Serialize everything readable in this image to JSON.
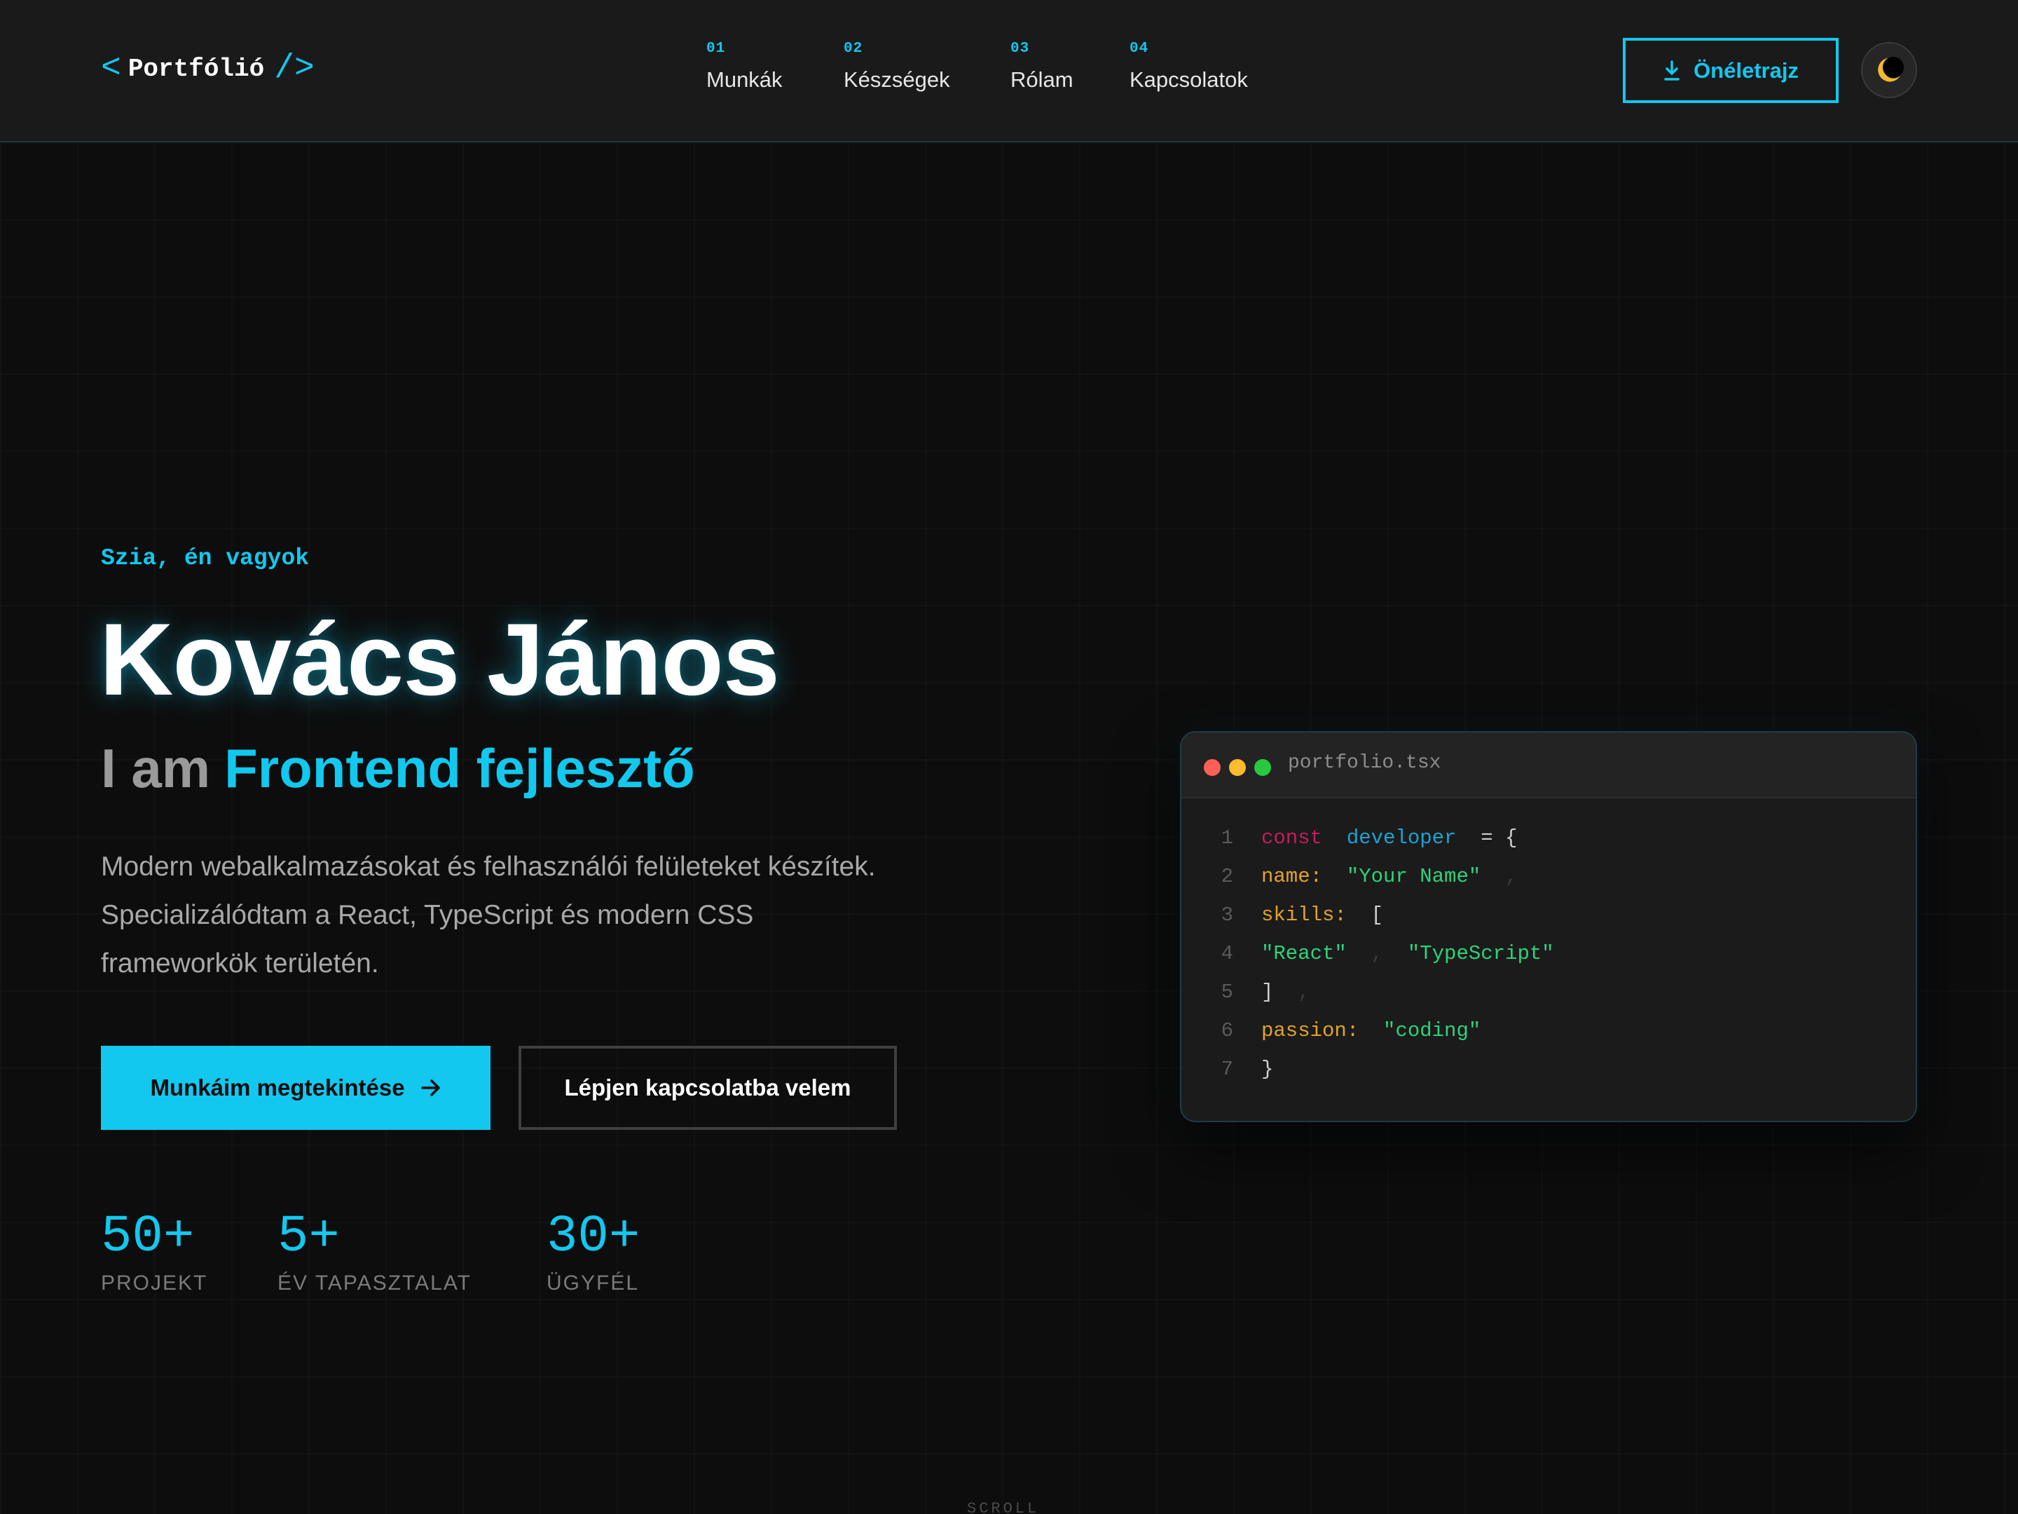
{
  "header": {
    "logo": {
      "open_bracket": "<",
      "text": "Portfólió",
      "close_bracket": "/>"
    },
    "nav": [
      {
        "num": "01",
        "label": "Munkák"
      },
      {
        "num": "02",
        "label": "Készségek"
      },
      {
        "num": "03",
        "label": "Rólam"
      },
      {
        "num": "04",
        "label": "Kapcsolatok"
      }
    ],
    "cv_button": {
      "label": "Önéletrajz",
      "icon": "download-icon"
    },
    "theme_toggle": {
      "icon": "moon-icon"
    }
  },
  "hero": {
    "greeting": "Szia, én vagyok",
    "name": "Kovács János",
    "role_prefix": "I am",
    "role_title": "Frontend fejlesztő",
    "description_lines": [
      "Modern webalkalmazásokat és felhasználói felületeket készítek.",
      "Specializálódtam a React, TypeScript és modern CSS",
      "frameworkök területén."
    ],
    "primary_button": {
      "label": "Munkáim megtekintése",
      "icon": "arrow-right-icon"
    },
    "secondary_button": {
      "label": "Lépjen kapcsolatba velem"
    },
    "stats": [
      {
        "value": "50+",
        "label": "PROJEKT"
      },
      {
        "value": "5+",
        "label": "ÉV TAPASZTALAT"
      },
      {
        "value": "30+",
        "label": "ÜGYFÉL"
      }
    ]
  },
  "code_window": {
    "filename": "portfolio.tsx",
    "lines": [
      {
        "n": "1",
        "tokens": [
          {
            "t": "const",
            "c": "kw"
          },
          {
            "t": "  ",
            "c": "op"
          },
          {
            "t": "developer",
            "c": "var"
          },
          {
            "t": "  = {",
            "c": "op"
          }
        ]
      },
      {
        "n": "2",
        "tokens": [
          {
            "t": "name:",
            "c": "key"
          },
          {
            "t": "  ",
            "c": "op"
          },
          {
            "t": "\"Your Name\"",
            "c": "str"
          },
          {
            "t": "  ,",
            "c": "punc"
          }
        ]
      },
      {
        "n": "3",
        "tokens": [
          {
            "t": "skills:",
            "c": "key"
          },
          {
            "t": "  [",
            "c": "op"
          }
        ]
      },
      {
        "n": "4",
        "tokens": [
          {
            "t": "\"React\"",
            "c": "str"
          },
          {
            "t": "  ,  ",
            "c": "punc"
          },
          {
            "t": "\"TypeScript\"",
            "c": "str"
          }
        ]
      },
      {
        "n": "5",
        "tokens": [
          {
            "t": "]",
            "c": "op"
          },
          {
            "t": "  ,",
            "c": "punc"
          }
        ]
      },
      {
        "n": "6",
        "tokens": [
          {
            "t": "passion:",
            "c": "key"
          },
          {
            "t": "  ",
            "c": "op"
          },
          {
            "t": "\"coding\"",
            "c": "str"
          }
        ]
      },
      {
        "n": "7",
        "tokens": [
          {
            "t": "}",
            "c": "op"
          }
        ]
      }
    ]
  },
  "scroll_hint": "SCROLL",
  "colors": {
    "accent": "#12c8ef",
    "background": "#0d0d0d",
    "header_bg": "#1a1a1a",
    "keyword": "#c21d5d",
    "variable": "#1da1d1",
    "property": "#e0a32a",
    "string": "#2ed27a",
    "moon": "#f5b82e"
  }
}
